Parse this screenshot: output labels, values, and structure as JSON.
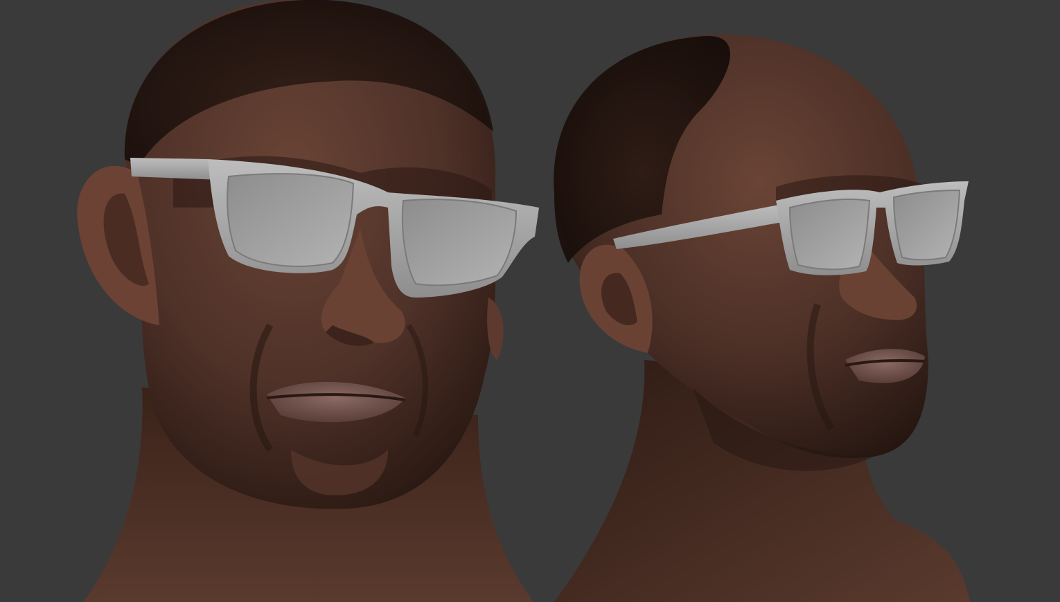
{
  "scene": {
    "background_color": "#3a3a3a",
    "skin_color": "#5a3a30",
    "skin_shadow_color": "#2a1814",
    "glasses_color": "#a8a8a8",
    "lens_color": "#9a9a9a",
    "views": [
      {
        "view": "front-three-quarter"
      },
      {
        "view": "side-three-quarter"
      }
    ]
  }
}
